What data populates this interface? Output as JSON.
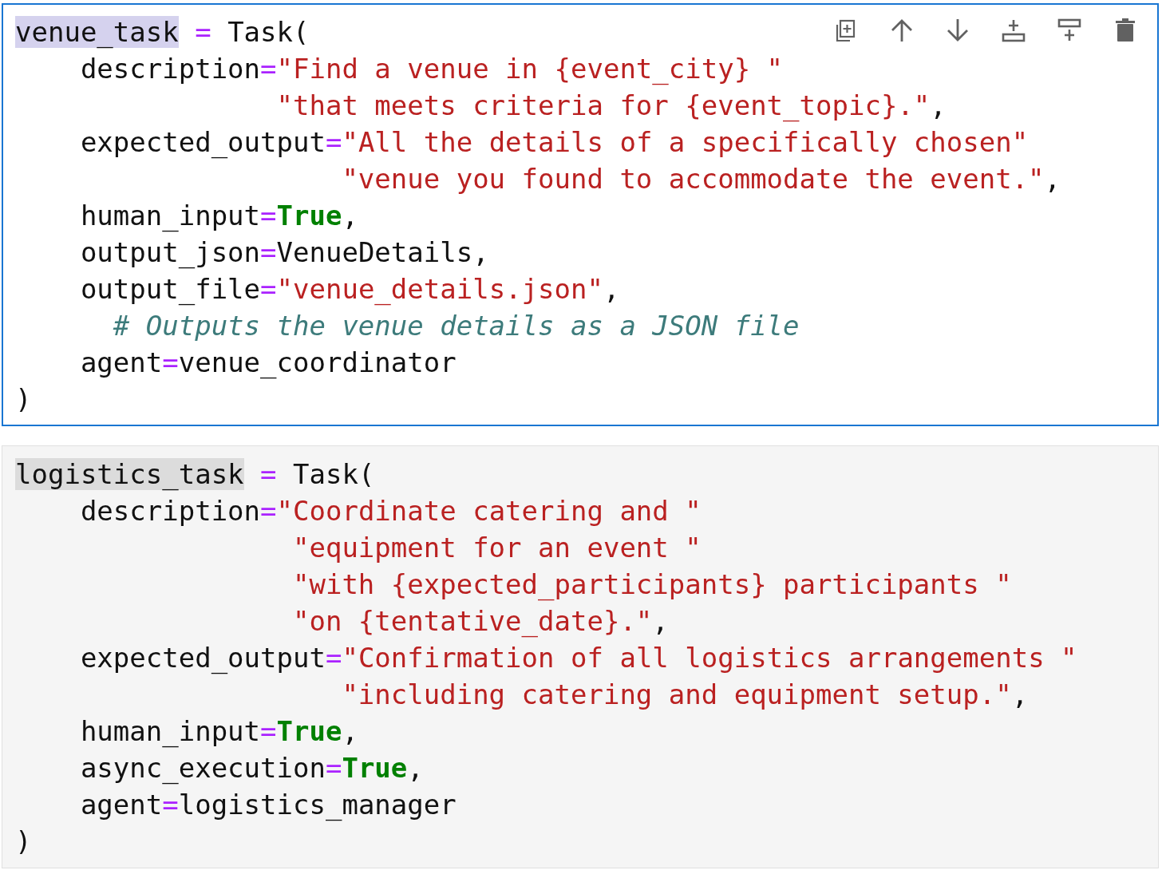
{
  "cells": [
    {
      "selected": true,
      "lines": [
        [
          {
            "text": "venue_task",
            "kind": "match"
          },
          {
            "text": " = ",
            "kind": "operator"
          },
          {
            "text": "Task(",
            "kind": "plain"
          }
        ],
        [
          {
            "text": "    description",
            "kind": "plain"
          },
          {
            "text": "=",
            "kind": "operator"
          },
          {
            "text": "\"Find a venue in {event_city} \"",
            "kind": "string"
          }
        ],
        [
          {
            "text": "                \"that meets criteria for {event_topic}.\"",
            "kind": "string"
          },
          {
            "text": ",",
            "kind": "plain"
          }
        ],
        [
          {
            "text": "    expected_output",
            "kind": "plain"
          },
          {
            "text": "=",
            "kind": "operator"
          },
          {
            "text": "\"All the details of a specifically chosen\"",
            "kind": "string"
          }
        ],
        [
          {
            "text": "                    \"venue you found to accommodate the event.\"",
            "kind": "string"
          },
          {
            "text": ",",
            "kind": "plain"
          }
        ],
        [
          {
            "text": "    human_input",
            "kind": "plain"
          },
          {
            "text": "=",
            "kind": "operator"
          },
          {
            "text": "True",
            "kind": "keyword"
          },
          {
            "text": ",",
            "kind": "plain"
          }
        ],
        [
          {
            "text": "    output_json",
            "kind": "plain"
          },
          {
            "text": "=",
            "kind": "operator"
          },
          {
            "text": "VenueDetails,",
            "kind": "plain"
          }
        ],
        [
          {
            "text": "    output_file",
            "kind": "plain"
          },
          {
            "text": "=",
            "kind": "operator"
          },
          {
            "text": "\"venue_details.json\"",
            "kind": "string"
          },
          {
            "text": ",",
            "kind": "plain"
          }
        ],
        [
          {
            "text": "      # Outputs the venue details as a JSON file",
            "kind": "comment"
          }
        ],
        [
          {
            "text": "    agent",
            "kind": "plain"
          },
          {
            "text": "=",
            "kind": "operator"
          },
          {
            "text": "venue_coordinator",
            "kind": "plain"
          }
        ],
        [
          {
            "text": ")",
            "kind": "plain"
          }
        ]
      ]
    },
    {
      "selected": false,
      "lines": [
        [
          {
            "text": "logistics_task",
            "kind": "match"
          },
          {
            "text": " = ",
            "kind": "operator"
          },
          {
            "text": "Task(",
            "kind": "plain"
          }
        ],
        [
          {
            "text": "    description",
            "kind": "plain"
          },
          {
            "text": "=",
            "kind": "operator"
          },
          {
            "text": "\"Coordinate catering and \"",
            "kind": "string"
          }
        ],
        [
          {
            "text": "                 \"equipment for an event \"",
            "kind": "string"
          }
        ],
        [
          {
            "text": "                 \"with {expected_participants} participants \"",
            "kind": "string"
          }
        ],
        [
          {
            "text": "                 \"on {tentative_date}.\"",
            "kind": "string"
          },
          {
            "text": ",",
            "kind": "plain"
          }
        ],
        [
          {
            "text": "    expected_output",
            "kind": "plain"
          },
          {
            "text": "=",
            "kind": "operator"
          },
          {
            "text": "\"Confirmation of all logistics arrangements \"",
            "kind": "string"
          }
        ],
        [
          {
            "text": "                    \"including catering and equipment setup.\"",
            "kind": "string"
          },
          {
            "text": ",",
            "kind": "plain"
          }
        ],
        [
          {
            "text": "    human_input",
            "kind": "plain"
          },
          {
            "text": "=",
            "kind": "operator"
          },
          {
            "text": "True",
            "kind": "keyword"
          },
          {
            "text": ",",
            "kind": "plain"
          }
        ],
        [
          {
            "text": "    async_execution",
            "kind": "plain"
          },
          {
            "text": "=",
            "kind": "operator"
          },
          {
            "text": "True",
            "kind": "keyword"
          },
          {
            "text": ",",
            "kind": "plain"
          }
        ],
        [
          {
            "text": "    agent",
            "kind": "plain"
          },
          {
            "text": "=",
            "kind": "operator"
          },
          {
            "text": "logistics_manager",
            "kind": "plain"
          }
        ],
        [
          {
            "text": ")",
            "kind": "plain"
          }
        ]
      ]
    }
  ]
}
